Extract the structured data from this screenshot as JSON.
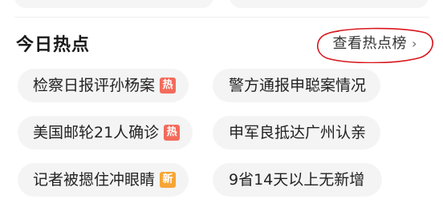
{
  "section": {
    "title": "今日热点",
    "view_more_label": "查看热点榜",
    "chevron_icon": "chevron-right-icon",
    "annotation_color": "#d9161c"
  },
  "topics": [
    {
      "label": "检察日报评孙杨案",
      "badge": "热",
      "badge_color": "#f36b5b"
    },
    {
      "label": "警方通报申聪案情况",
      "badge": null,
      "badge_color": null
    },
    {
      "label": "美国邮轮21人确诊",
      "badge": "热",
      "badge_color": "#f36b5b"
    },
    {
      "label": "申军良抵达广州认亲",
      "badge": null,
      "badge_color": null
    },
    {
      "label": "记者被摁住冲眼睛",
      "badge": "新",
      "badge_color": "#f7a535"
    },
    {
      "label": "9省14天以上无新增",
      "badge": null,
      "badge_color": null
    }
  ]
}
